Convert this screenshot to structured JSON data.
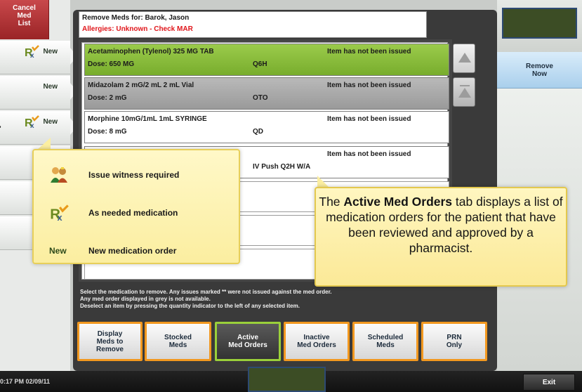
{
  "left": {
    "cancel_label": "Cancel\nMed\nList",
    "items": [
      {
        "label": "New",
        "has_prn": true
      },
      {
        "label": "New",
        "has_prn": false
      },
      {
        "label": "New",
        "has_prn": true
      }
    ]
  },
  "header": {
    "title": "Remove Meds for: Barok, Jason",
    "allergies": "Allergies: Unknown - Check MAR"
  },
  "rows": [
    {
      "drug": "Acetaminophen (Tylenol) 325 MG TAB",
      "dose": "Dose: 650 MG",
      "freq": "Q6H",
      "status": "Item has not been issued",
      "style": "green"
    },
    {
      "drug": "Midazolam 2 mG/2 mL 2 mL Vial",
      "dose": "Dose: 2 mG",
      "freq": "OTO",
      "status": "Item has not been issued",
      "style": "grey"
    },
    {
      "drug": "Morphine 10mG/1mL 1mL SYRINGE",
      "dose": "Dose: 8 mG",
      "freq": "QD",
      "status": "Item has not been issued",
      "style": "plain"
    },
    {
      "drug": "",
      "dose": "",
      "freq": "IV Push  Q2H W/A",
      "status": "Item has not been issued",
      "style": "plain"
    }
  ],
  "right": {
    "remove_now_label": "Remove\nNow"
  },
  "instructions": [
    "Select the medication to remove. Any issues marked ** were not issued against the med order.",
    "Any med order displayed in grey is not available.",
    "Deselect an item by pressing the quantity indicator to the left of any selected item."
  ],
  "tabs": [
    {
      "label": "Display\nMeds to\nRemove",
      "active": false
    },
    {
      "label": "Stocked\nMeds",
      "active": false
    },
    {
      "label": "Active\nMed Orders",
      "active": true
    },
    {
      "label": "Inactive\nMed Orders",
      "active": false
    },
    {
      "label": "Scheduled\nMeds",
      "active": false
    },
    {
      "label": "PRN\nOnly",
      "active": false
    }
  ],
  "legend": {
    "witness": "Issue witness required",
    "prn": "As needed medication",
    "new_icon": "New",
    "new": "New medication order"
  },
  "info": {
    "prefix": "The ",
    "bold": "Active Med Orders",
    "rest": " tab displays a list of medication orders for the patient that have been reviewed and approved by a pharmacist."
  },
  "footer": {
    "time": "0:17 PM  02/09/11",
    "exit_label": "Exit"
  },
  "colors": {
    "selected_row": "#8bc03f",
    "unavailable_row": "#aaaaaa",
    "tab_border": "#f2981f",
    "active_tab_border": "#9ad03a",
    "allergy_text": "#e0161b",
    "remove_now": "#bfe0f6"
  },
  "icons": [
    "prn-rx-icon",
    "witness-icon",
    "scroll-up-icon",
    "scroll-top-icon"
  ]
}
